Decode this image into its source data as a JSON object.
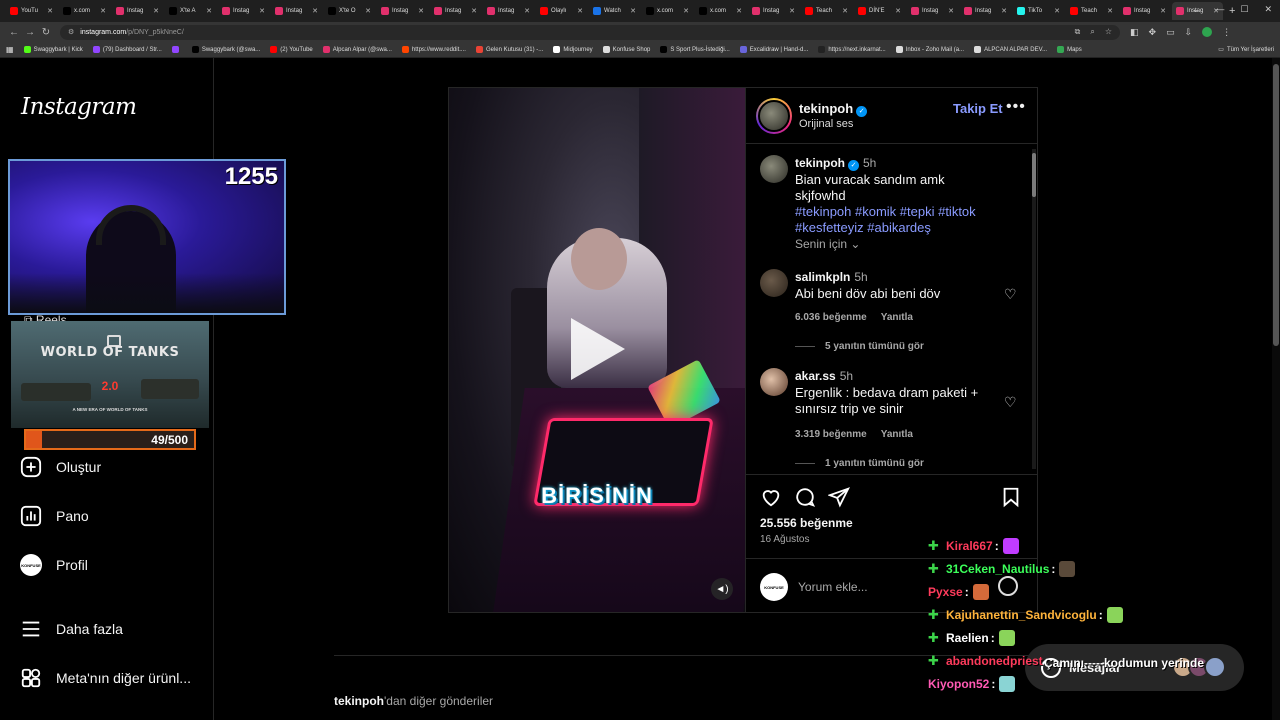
{
  "browser": {
    "tabs": [
      {
        "title": "YouTu",
        "color": "#ff0000",
        "active": false
      },
      {
        "title": "x.com",
        "color": "#000000",
        "active": false
      },
      {
        "title": "Instag",
        "color": "#e1306c",
        "active": false
      },
      {
        "title": "X'te A",
        "color": "#000000",
        "active": false
      },
      {
        "title": "Instag",
        "color": "#e1306c",
        "active": false
      },
      {
        "title": "Instag",
        "color": "#e1306c",
        "active": false
      },
      {
        "title": "X'te O",
        "color": "#000000",
        "active": false
      },
      {
        "title": "Instag",
        "color": "#e1306c",
        "active": false
      },
      {
        "title": "Instag",
        "color": "#e1306c",
        "active": false
      },
      {
        "title": "Instag",
        "color": "#e1306c",
        "active": false
      },
      {
        "title": "Olaylı",
        "color": "#ff0000",
        "active": false
      },
      {
        "title": "Watch",
        "color": "#1a73e8",
        "active": false
      },
      {
        "title": "x.com",
        "color": "#000000",
        "active": false
      },
      {
        "title": "x.com",
        "color": "#000000",
        "active": false
      },
      {
        "title": "Instag",
        "color": "#e1306c",
        "active": false
      },
      {
        "title": "Teach",
        "color": "#ff0000",
        "active": false
      },
      {
        "title": "DİN'E",
        "color": "#ff0000",
        "active": false
      },
      {
        "title": "Instag",
        "color": "#e1306c",
        "active": false
      },
      {
        "title": "Instag",
        "color": "#e1306c",
        "active": false
      },
      {
        "title": "TikTo",
        "color": "#25f4ee",
        "active": false
      },
      {
        "title": "Teach",
        "color": "#ff0000",
        "active": false
      },
      {
        "title": "Instag",
        "color": "#e1306c",
        "active": false
      },
      {
        "title": "Instag",
        "color": "#e1306c",
        "active": true
      }
    ],
    "new_tab": "+",
    "url_domain": "instagram.com",
    "url_path": "/p/DNY_p5kNneC/",
    "bookmarks": [
      {
        "label": "Swaggybark | Kick",
        "color": "#53fc18"
      },
      {
        "label": "(79) Dashboard / Str...",
        "color": "#9146ff"
      },
      {
        "label": "",
        "color": "#9146ff"
      },
      {
        "label": "Swaggybark (@swa...",
        "color": "#000000"
      },
      {
        "label": "(2) YouTube",
        "color": "#ff0000"
      },
      {
        "label": "Alpcan Alpar (@swa...",
        "color": "#e1306c"
      },
      {
        "label": "https://www.reddit....",
        "color": "#ff4500"
      },
      {
        "label": "Gelen Kutusu (31) -...",
        "color": "#ea4335"
      },
      {
        "label": "Midjourney",
        "color": "#ffffff"
      },
      {
        "label": "Konfuse Shop",
        "color": "#dddddd"
      },
      {
        "label": "S Sport Plus-İstediği...",
        "color": "#000000"
      },
      {
        "label": "Excalidraw | Hand-d...",
        "color": "#6965db"
      },
      {
        "label": "https://next.inkarnat...",
        "color": "#222222"
      },
      {
        "label": "Inbox - Zoho Mail (a...",
        "color": "#dddddd"
      },
      {
        "label": "ALPCAN ALPAR DEV...",
        "color": "#dddddd"
      },
      {
        "label": "Maps",
        "color": "#34a853"
      }
    ],
    "all_bookmarks": "Tüm Yer İşaretleri"
  },
  "sidebar": {
    "logo": "Instagram",
    "reels_peek": "Reels",
    "items": [
      {
        "label": "Oluştur",
        "icon": "plus-square-icon"
      },
      {
        "label": "Pano",
        "icon": "dashboard-icon"
      },
      {
        "label": "Profil",
        "icon": "profile-avatar"
      },
      {
        "label": "Daha fazla",
        "icon": "menu-icon"
      },
      {
        "label": "Meta'nın diğer ürünl...",
        "icon": "meta-apps-icon"
      }
    ],
    "profile_avatar_text": "KONFUSE"
  },
  "stream_overlay": {
    "webcam_count": "1255",
    "game_title_line1": "WORLD OF TANKS",
    "game_version": "2.0",
    "game_tagline": "A NEW ERA OF WORLD OF TANKS",
    "goal_text": "49/500",
    "goal_fraction": 0.098
  },
  "post": {
    "video_caption": "BİRİSİNİN",
    "username": "tekinpoh",
    "audio": "Orijinal ses",
    "follow": "Takip Et",
    "more": "•••",
    "caption": {
      "username": "tekinpoh",
      "time": "5h",
      "text": "Bian vuracak sandım amk skjfowhd",
      "hashtags_line1": "#tekinpoh #komik #tepki #tiktok",
      "hashtags_line2": "#kesfetteyiz #abikardeş"
    },
    "for_you": "Senin için",
    "comments": [
      {
        "username": "salimkpln",
        "time": "5h",
        "text": "Abi beni döv abi beni döv",
        "likes": "6.036 beğenme",
        "reply": "Yanıtla",
        "replies": "5 yanıtın tümünü gör"
      },
      {
        "username": "akar.ss",
        "time": "5h",
        "text": "Ergenlik : bedava dram paketi + sınırsız trip ve sinir",
        "likes": "3.319 beğenme",
        "reply": "Yanıtla",
        "replies": "1 yanıtın tümünü gör"
      }
    ],
    "likes": "25.556 beğenme",
    "date": "16 Ağustos",
    "add_comment_placeholder": "Yorum ekle...",
    "my_avatar_text": "KONFUSE"
  },
  "more_posts": {
    "username": "tekinpoh",
    "suffix": "'dan diğer gönderiler"
  },
  "chat": [
    {
      "user": "Kiral667",
      "color": "#ff3b5c",
      "badge": true,
      "emote_color": "#c03cff"
    },
    {
      "user": "31Ceken_Nautilus",
      "color": "#3cff5a",
      "badge": true,
      "emote_color": "#5a4a3a"
    },
    {
      "user": "Pyxse",
      "color": "#ff3b5c",
      "badge": false,
      "emote_color": "#d46a3a"
    },
    {
      "user": "Kajuhanettin_Sandvicoglu",
      "color": "#ffb43c",
      "badge": true,
      "emote_color": "#8ad45a"
    },
    {
      "user": "Raelien",
      "color": "#ffffff",
      "badge": true,
      "emote_color": "#8ad45a"
    },
    {
      "user": "abandonedpriest",
      "color": "#ff3b5c",
      "badge": true,
      "emote_color": ""
    },
    {
      "user": "Kiyopon52",
      "color": "#ff5ab4",
      "badge": false,
      "emote_color": "#8ad4d4"
    }
  ],
  "chat_overlay_text": "Çamını-----kodumun yerinde",
  "messages": {
    "label": "Mesajlar"
  }
}
